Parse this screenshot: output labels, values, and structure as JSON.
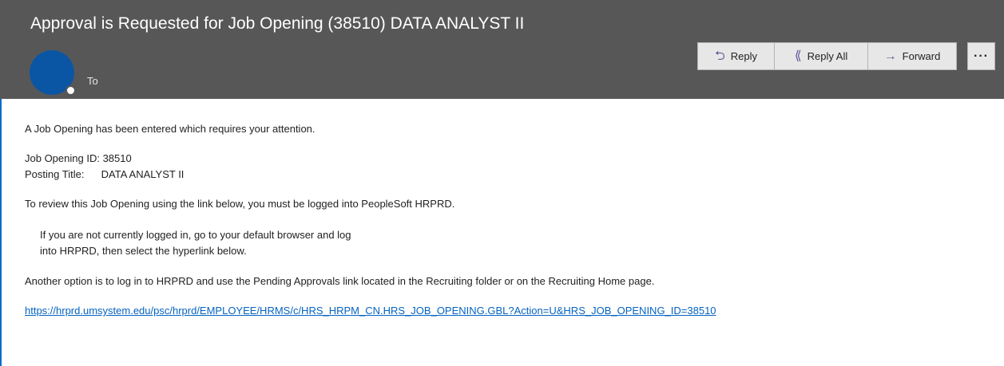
{
  "email": {
    "subject": "Approval is Requested for Job Opening (38510) DATA ANALYST II",
    "to_label": "To"
  },
  "toolbar": {
    "reply_label": "Reply",
    "reply_all_label": "Reply All",
    "forward_label": "Forward",
    "more_label": "···"
  },
  "body": {
    "intro": "A Job Opening has been entered which requires your attention.",
    "job_opening_id_label": "Job Opening ID:",
    "job_opening_id_value": "38510",
    "posting_title_label": "Posting Title:",
    "posting_title_value": "DATA ANALYST II",
    "review_note": "To review this Job Opening using the link below, you must be logged into PeopleSoft HRPRD.",
    "login_note_line1": "If you are not currently logged in, go to your default browser and log",
    "login_note_line2": "into HRPRD, then select the hyperlink below.",
    "another_option": "Another option is to log in to HRPRD and use the Pending Approvals link located in the Recruiting folder or on the Recruiting Home page.",
    "link": "https://hrprd.umsystem.edu/psc/hrprd/EMPLOYEE/HRMS/c/HRS_HRPM_CN.HRS_JOB_OPENING.GBL?Action=U&HRS_JOB_OPENING_ID=38510"
  },
  "colors": {
    "header_bg": "#575757",
    "avatar": "#0b56a4",
    "link": "#0563c1",
    "accent_border": "#0b6bc8"
  }
}
